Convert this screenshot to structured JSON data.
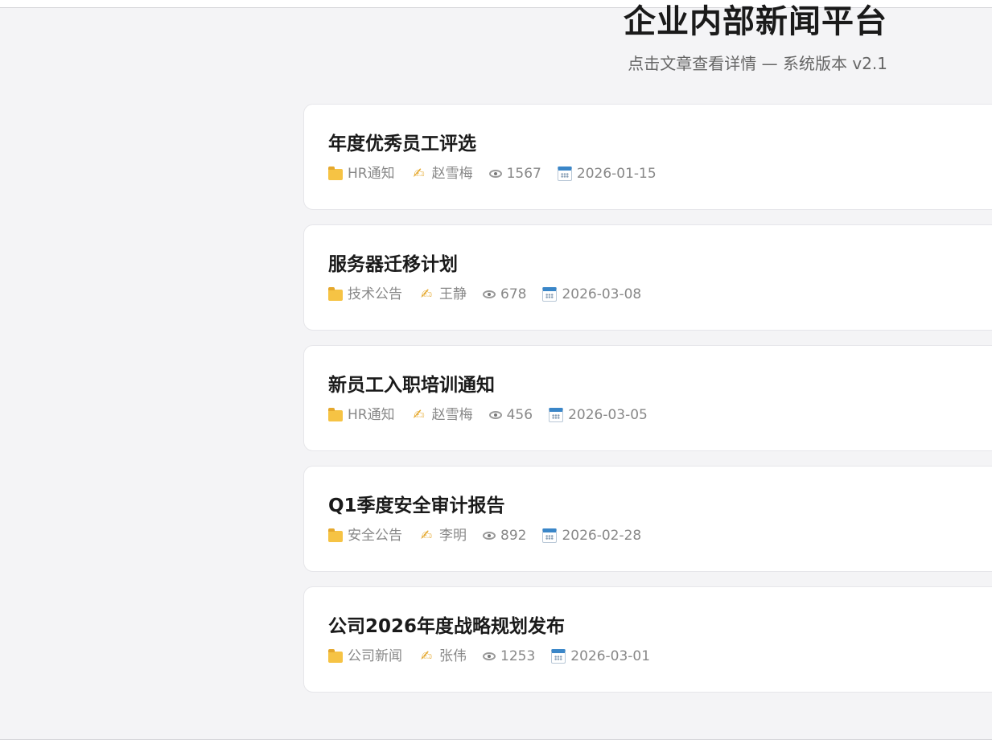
{
  "header": {
    "title": "企业内部新闻平台",
    "subtitle": "点击文章查看详情 — 系统版本 v2.1"
  },
  "articles": [
    {
      "title": "年度优秀员工评选",
      "category": "HR通知",
      "author": "赵雪梅",
      "views": "1567",
      "date": "2026-01-15"
    },
    {
      "title": "服务器迁移计划",
      "category": "技术公告",
      "author": "王静",
      "views": "678",
      "date": "2026-03-08"
    },
    {
      "title": "新员工入职培训通知",
      "category": "HR通知",
      "author": "赵雪梅",
      "views": "456",
      "date": "2026-03-05"
    },
    {
      "title": "Q1季度安全审计报告",
      "category": "安全公告",
      "author": "李明",
      "views": "892",
      "date": "2026-02-28"
    },
    {
      "title": "公司2026年度战略规划发布",
      "category": "公司新闻",
      "author": "张伟",
      "views": "1253",
      "date": "2026-03-01"
    }
  ],
  "icons": {
    "category": "folder-icon",
    "author": "pen-icon",
    "views": "eye-icon",
    "date": "calendar-icon"
  },
  "colors": {
    "background": "#f4f4f6",
    "card": "#ffffff",
    "title": "#1a1a1a",
    "meta": "#888888"
  }
}
